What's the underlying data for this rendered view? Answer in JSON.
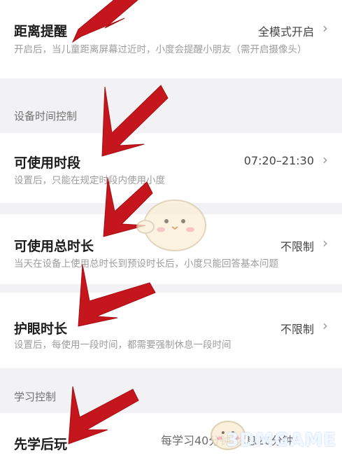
{
  "rows": {
    "distance": {
      "title": "距离提醒",
      "value": "全模式开启",
      "desc": "开启后，当儿童距离屏幕过近时，小度会提醒小朋友（需开启摄像头）"
    },
    "time_slot": {
      "title": "可使用时段",
      "value": "07:20–21:30",
      "desc": "设置后，只能在规定时段内使用小度"
    },
    "total_time": {
      "title": "可使用总时长",
      "value": "不限制",
      "desc": "当天在设备上使用总时长到预设时长后，小度只能回答基本问题"
    },
    "eye_care": {
      "title": "护眼时长",
      "value": "不限制",
      "desc": "设置后，每使用一段时间，都需要强制休息一段时间"
    },
    "study_first": {
      "title": "先学后玩",
      "value": "每学习40分钟 休息20分钟"
    }
  },
  "sections": {
    "device_time": "设备时间控制",
    "study": "学习控制"
  },
  "chevron": "›",
  "watermark": "3DMGAME",
  "colors": {
    "arrow_red": "#c4161c",
    "title": "#1c1c1c",
    "desc": "#9d9d9d",
    "bg": "#f2f2f4"
  }
}
